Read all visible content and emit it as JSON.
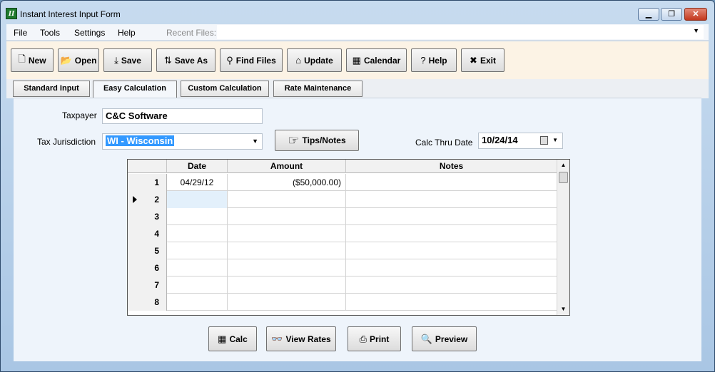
{
  "window": {
    "title": "Instant Interest Input Form",
    "icon": "app-logo-icon",
    "controls": {
      "minimize": "▁",
      "maximize": "❐",
      "close": "✕"
    }
  },
  "menu": {
    "items": [
      "File",
      "Tools",
      "Settings",
      "Help"
    ],
    "recent_files_label": "Recent Files:",
    "recent_files_value": ""
  },
  "toolbar": {
    "buttons": [
      {
        "label": "New",
        "icon": "new-document-icon",
        "glyph": "🗋"
      },
      {
        "label": "Open",
        "icon": "open-folder-icon",
        "glyph": "📂"
      },
      {
        "label": "Save",
        "icon": "save-icon",
        "glyph": "⤓"
      },
      {
        "label": "Save As",
        "icon": "save-as-icon",
        "glyph": "⇅"
      },
      {
        "label": "Find Files",
        "icon": "binoculars-icon",
        "glyph": "⚲"
      },
      {
        "label": "Update",
        "icon": "update-house-icon",
        "glyph": "⌂"
      },
      {
        "label": "Calendar",
        "icon": "calendar-icon",
        "glyph": "▦"
      },
      {
        "label": "Help",
        "icon": "question-icon",
        "glyph": "?"
      },
      {
        "label": "Exit",
        "icon": "exit-x-icon",
        "glyph": "✖"
      }
    ]
  },
  "tabs": [
    {
      "label": "Standard Input"
    },
    {
      "label": "Easy Calculation",
      "active": true
    },
    {
      "label": "Custom Calculation"
    },
    {
      "label": "Rate Maintenance"
    }
  ],
  "form": {
    "taxpayer_label": "Taxpayer",
    "taxpayer_value": "C&C Software",
    "jurisdiction_label": "Tax Jurisdiction",
    "jurisdiction_value": "WI - Wisconsin",
    "tips_button": "Tips/Notes",
    "tips_glyph": "☞",
    "calc_thru_label": "Calc Thru Date",
    "calc_thru_value": "10/24/14"
  },
  "grid": {
    "columns": [
      "Date",
      "Amount",
      "Notes"
    ],
    "current_row": 2,
    "rows": [
      {
        "num": "1",
        "date": "04/29/12",
        "amount": "($50,000.00)",
        "notes": ""
      },
      {
        "num": "2",
        "date": "",
        "amount": "",
        "notes": ""
      },
      {
        "num": "3",
        "date": "",
        "amount": "",
        "notes": ""
      },
      {
        "num": "4",
        "date": "",
        "amount": "",
        "notes": ""
      },
      {
        "num": "5",
        "date": "",
        "amount": "",
        "notes": ""
      },
      {
        "num": "6",
        "date": "",
        "amount": "",
        "notes": ""
      },
      {
        "num": "7",
        "date": "",
        "amount": "",
        "notes": ""
      },
      {
        "num": "8",
        "date": "",
        "amount": "",
        "notes": ""
      }
    ]
  },
  "actions": {
    "buttons": [
      {
        "label": "Calc",
        "icon": "calculator-icon",
        "glyph": "▦"
      },
      {
        "label": "View Rates",
        "icon": "glasses-icon",
        "glyph": "👓"
      },
      {
        "label": "Print",
        "icon": "printer-icon",
        "glyph": "⎙"
      },
      {
        "label": "Preview",
        "icon": "preview-icon",
        "glyph": "🔍"
      }
    ]
  }
}
